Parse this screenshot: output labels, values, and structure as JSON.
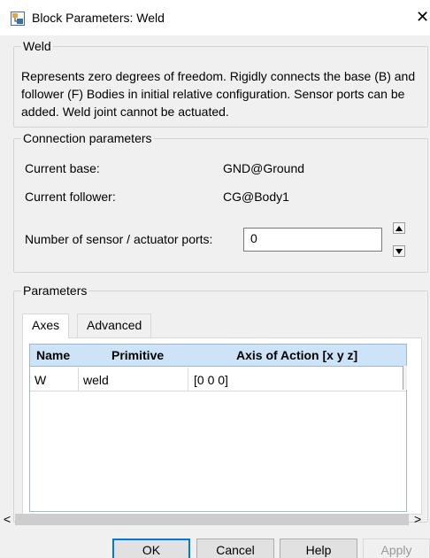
{
  "window": {
    "title": "Block Parameters: Weld",
    "close_glyph": "✕",
    "app_icon": "simulink-block-icon"
  },
  "weld_group": {
    "legend": "Weld",
    "description": "Represents zero degrees of freedom. Rigidly connects the base (B) and follower (F) Bodies in initial relative configuration. Sensor ports can be added. Weld joint cannot be actuated."
  },
  "connection": {
    "legend": "Connection parameters",
    "base_label": "Current base:",
    "base_value": "GND@Ground",
    "follower_label": "Current follower:",
    "follower_value": "CG@Body1",
    "ports_label": "Number of sensor / actuator ports:",
    "ports_value": "0"
  },
  "parameters": {
    "legend": "Parameters",
    "tabs": [
      {
        "label": "Axes",
        "active": true
      },
      {
        "label": "Advanced",
        "active": false
      }
    ],
    "table": {
      "headers": [
        "Name",
        "Primitive",
        "Axis of Action [x y z]"
      ],
      "rows": [
        [
          "W",
          "weld",
          "[0 0 0]"
        ]
      ]
    }
  },
  "scrollbar": {
    "left_arrow": "<",
    "right_arrow": ">"
  },
  "buttons": {
    "ok": "OK",
    "cancel": "Cancel",
    "help": "Help",
    "apply": "Apply"
  },
  "colors": {
    "table_header": "#cde3f8",
    "default_button_border": "#0078d7"
  }
}
